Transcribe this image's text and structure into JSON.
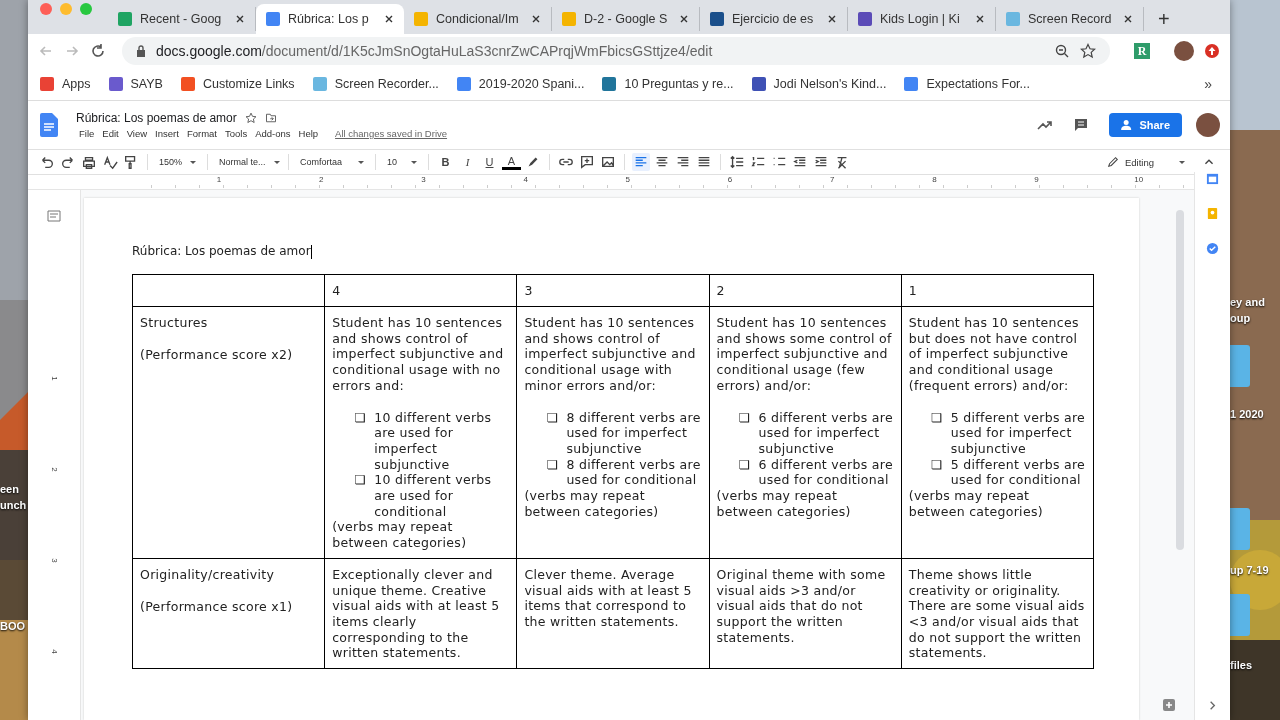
{
  "desktop": {
    "labels_left": [
      "een",
      "unch",
      "BOO"
    ],
    "labels_right": [
      "ey and",
      "oup",
      "1 2020",
      "up 7-19",
      "files"
    ]
  },
  "browser": {
    "tabs": [
      {
        "title": "Recent - Goog",
        "kind": "drive",
        "selected": false
      },
      {
        "title": "Rúbrica: Los p",
        "kind": "docs",
        "selected": true
      },
      {
        "title": "Condicional/Im",
        "kind": "slides",
        "selected": false
      },
      {
        "title": "D-2 - Google S",
        "kind": "slides",
        "selected": false
      },
      {
        "title": "Ejercicio de es",
        "kind": "tc",
        "selected": false
      },
      {
        "title": "Kids Login | Ki",
        "kind": "kids",
        "selected": false
      },
      {
        "title": "Screen Record",
        "kind": "rec",
        "selected": false
      }
    ],
    "new_tab": "+",
    "url_host": "docs.google.com",
    "url_path": "/document/d/1K5cJmSnOgtaHuLaS3cnrZwCAPrqjWmFbicsGSttjze4/edit",
    "extension_badge": "R",
    "bookmarks": [
      {
        "label": "Apps",
        "kind": "apps"
      },
      {
        "label": "SAYB",
        "kind": "sayb"
      },
      {
        "label": "Customize Links",
        "kind": "ms"
      },
      {
        "label": "Screen Recorder...",
        "kind": "rec"
      },
      {
        "label": "2019-2020 Spani...",
        "kind": "docs"
      },
      {
        "label": "10 Preguntas y re...",
        "kind": "wp"
      },
      {
        "label": "Jodi Nelson's Kind...",
        "kind": "site"
      },
      {
        "label": "Expectations For...",
        "kind": "docs"
      }
    ],
    "bookmarks_more": "»"
  },
  "docs": {
    "title": "Rúbrica: Los poemas de amor",
    "menus": [
      "File",
      "Edit",
      "View",
      "Insert",
      "Format",
      "Tools",
      "Add-ons",
      "Help"
    ],
    "save_status": "All changes saved in Drive",
    "share": "Share",
    "toolbar": {
      "zoom": "150%",
      "style": "Normal te...",
      "font": "Comfortaa",
      "size": "10",
      "format_buttons": [
        "B",
        "I",
        "U",
        "A"
      ],
      "mode": "Editing"
    },
    "ruler": [
      "1",
      "2",
      "3",
      "4",
      "5",
      "6",
      "7",
      "8",
      "9",
      "10"
    ],
    "vertical_ruler": [
      "1",
      "2",
      "3",
      "4"
    ],
    "heading": "Rúbrica: Los poemas de amor",
    "table": {
      "header": [
        "4",
        "3",
        "2",
        "1"
      ],
      "rows": [
        {
          "cells": [
            {
              "blocks": [
                {
                  "kind": "text",
                  "text": "Structures"
                },
                {
                  "kind": "text",
                  "text": "(Performance score x2)"
                }
              ]
            },
            {
              "blocks": [
                {
                  "kind": "text",
                  "text": "Student has 10 sentences and shows control of imperfect subjunctive and conditional usage with no errors and:"
                },
                {
                  "kind": "list",
                  "items": [
                    {
                      "marker": "❏",
                      "text": "10 different verbs are used for imperfect subjunctive"
                    },
                    {
                      "marker": "❏",
                      "text": "10 different verbs are used for conditional"
                    }
                  ]
                },
                {
                  "kind": "text",
                  "text": "(verbs may repeat between categories)"
                }
              ]
            },
            {
              "blocks": [
                {
                  "kind": "text",
                  "text": "Student has 10 sentences and shows control of imperfect subjunctive and conditional usage with minor errors and/or:"
                },
                {
                  "kind": "list",
                  "items": [
                    {
                      "marker": "❏",
                      "text": "8 different verbs are used for imperfect subjunctive"
                    },
                    {
                      "marker": "❏",
                      "text": "8 different verbs are used for conditional"
                    }
                  ]
                },
                {
                  "kind": "text",
                  "text": "(verbs may repeat between categories)"
                }
              ]
            },
            {
              "blocks": [
                {
                  "kind": "text",
                  "text": "Student has 10 sentences and shows some control of imperfect subjunctive and conditional usage (few errors) and/or:"
                },
                {
                  "kind": "list",
                  "items": [
                    {
                      "marker": "❏",
                      "text": "6 different verbs are used for imperfect subjunctive"
                    },
                    {
                      "marker": "❏",
                      "text": "6 different verbs are used for conditional"
                    }
                  ]
                },
                {
                  "kind": "text",
                  "text": "(verbs may repeat between categories)"
                }
              ]
            },
            {
              "blocks": [
                {
                  "kind": "text",
                  "text": "Student has 10 sentences but does not have control of imperfect subjunctive and conditional usage (frequent errors) and/or:"
                },
                {
                  "kind": "list",
                  "items": [
                    {
                      "marker": "❏",
                      "text": "5 different verbs are used for imperfect subjunctive"
                    },
                    {
                      "marker": "❏",
                      "text": "5 different verbs are used for conditional"
                    }
                  ]
                },
                {
                  "kind": "text",
                  "text": "(verbs may repeat between categories)"
                }
              ]
            }
          ]
        },
        {
          "cells": [
            {
              "blocks": [
                {
                  "kind": "text",
                  "text": "Originality/creativity"
                },
                {
                  "kind": "text",
                  "text": "(Performance score x1)"
                }
              ]
            },
            {
              "blocks": [
                {
                  "kind": "text",
                  "text": "Exceptionally clever and unique theme. Creative visual aids with at least 5 items clearly corresponding to the written statements."
                }
              ]
            },
            {
              "blocks": [
                {
                  "kind": "text",
                  "text": "Clever theme. Average visual aids with at least 5 items that correspond to the written statements."
                }
              ]
            },
            {
              "blocks": [
                {
                  "kind": "text",
                  "text": "Original theme with some visual aids >3 and/or visual aids that do not support the written statements."
                }
              ]
            },
            {
              "blocks": [
                {
                  "kind": "text",
                  "text": "Theme shows little creativity or originality. There are some visual aids <3 and/or visual aids that do not support the written statements."
                }
              ]
            }
          ]
        }
      ]
    }
  }
}
